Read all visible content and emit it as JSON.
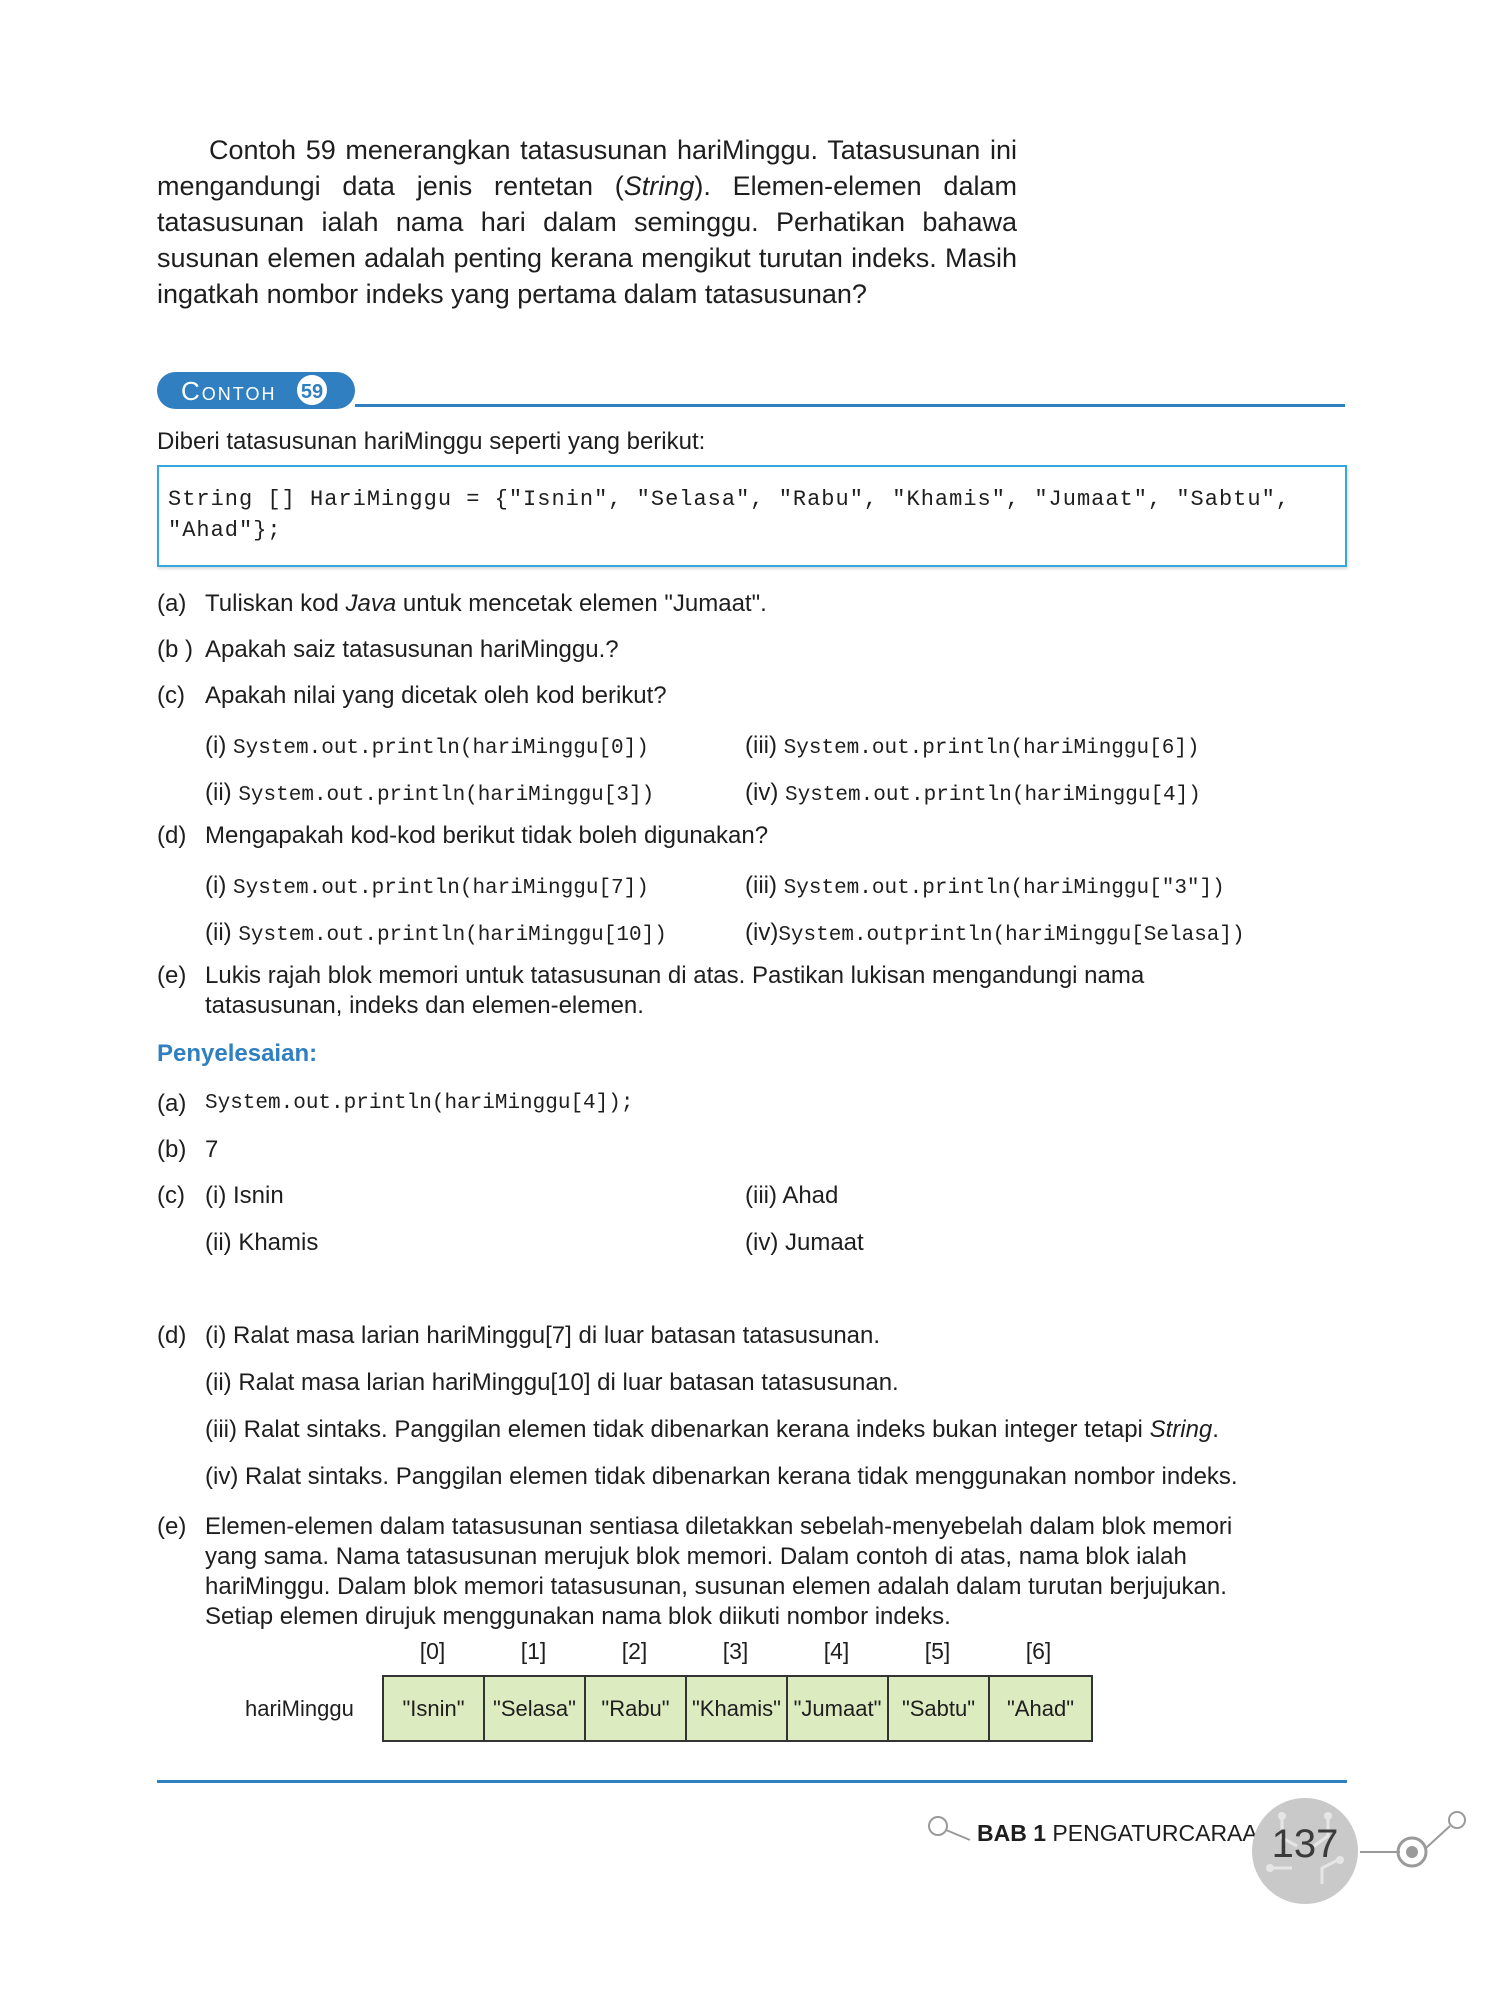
{
  "intro": {
    "text_before": "Contoh 59 menerangkan tatasusunan hariMinggu. Tatasusunan ini mengandungi data jenis rentetan (",
    "text_italic": "String",
    "text_after": "). Elemen-elemen dalam tatasusunan ialah nama hari dalam seminggu. Perhatikan bahawa susunan elemen adalah penting kerana mengikut turutan indeks. Masih ingatkah nombor indeks yang pertama dalam tatasusunan?"
  },
  "example": {
    "label": "Contoh",
    "number": "59",
    "lead": "Diberi tatasusunan hariMinggu seperti yang berikut:",
    "code_line1": "String [] HariMinggu = {\"Isnin\", \"Selasa\", \"Rabu\", \"Khamis\", \"Jumaat\", \"Sabtu\",",
    "code_line2": "\"Ahad\"};"
  },
  "questions": {
    "a_mark": "(a)",
    "a_pre": "Tuliskan kod ",
    "a_it": "Java",
    "a_post": " untuk mencetak elemen \"Jumaat\".",
    "b_mark": "(b )",
    "b_text": "Apakah saiz tatasusunan hariMinggu.?",
    "c_mark": "(c)",
    "c_text": "Apakah nilai yang dicetak oleh kod berikut?",
    "c_i_mark": "(i)",
    "c_i_code": "System.out.println(hariMinggu[0])",
    "c_iii_mark": "(iii)",
    "c_iii_code": "System.out.println(hariMinggu[6])",
    "c_ii_mark": "(ii)",
    "c_ii_code": "System.out.println(hariMinggu[3])",
    "c_iv_mark": "(iv)",
    "c_iv_code": "System.out.println(hariMinggu[4])",
    "d_mark": "(d)",
    "d_text": "Mengapakah kod-kod berikut tidak boleh digunakan?",
    "d_i_mark": "(i)",
    "d_i_code": "System.out.println(hariMinggu[7])",
    "d_iii_mark": "(iii)",
    "d_iii_code": "System.out.println(hariMinggu[\"3\"])",
    "d_ii_mark": "(ii)",
    "d_ii_code": "System.out.println(hariMinggu[10])",
    "d_iv_mark": "(iv)",
    "d_iv_code": "System.outprintln(hariMinggu[Selasa])",
    "e_mark": "(e)",
    "e_line1": "Lukis rajah blok memori untuk tatasusunan di atas. Pastikan lukisan mengandungi nama",
    "e_line2": "tatasusunan, indeks dan elemen-elemen."
  },
  "solution": {
    "heading": "Penyelesaian:",
    "a_mark": "(a)",
    "a_code": "System.out.println(hariMinggu[4]);",
    "b_mark": "(b)",
    "b_text": "7",
    "c_mark": "(c)",
    "c_i": "(i)  Isnin",
    "c_iii": "(iii)  Ahad",
    "c_ii": "(ii)  Khamis",
    "c_iv": "(iv)  Jumaat",
    "d_mark": "(d)",
    "d_i": "(i)  Ralat masa larian hariMinggu[7] di luar batasan tatasusunan.",
    "d_ii": "(ii)  Ralat masa larian hariMinggu[10] di luar batasan tatasusunan.",
    "d_iii_pre": "(iii) Ralat sintaks. Panggilan elemen tidak dibenarkan kerana indeks bukan integer tetapi ",
    "d_iii_it": "String",
    "d_iii_post": ".",
    "d_iv": "(iv) Ralat sintaks. Panggilan elemen tidak dibenarkan kerana tidak menggunakan nombor indeks.",
    "e_mark": "(e)",
    "e_line1": "Elemen-elemen dalam tatasusunan sentiasa diletakkan sebelah-menyebelah dalam blok memori",
    "e_line2": "yang sama. Nama tatasusunan merujuk blok memori. Dalam contoh di atas, nama blok ialah",
    "e_line3": "hariMinggu. Dalam blok memori tatasusunan, susunan elemen adalah dalam turutan berjujukan.",
    "e_line4": "Setiap elemen dirujuk menggunakan nama blok diikuti nombor indeks."
  },
  "memory_block": {
    "array_name": "hariMinggu",
    "indices": [
      "[0]",
      "[1]",
      "[2]",
      "[3]",
      "[4]",
      "[5]",
      "[6]"
    ],
    "elements": [
      "\"Isnin\"",
      "\"Selasa\"",
      "\"Rabu\"",
      "\"Khamis\"",
      "\"Jumaat\"",
      "\"Sabtu\"",
      "\"Ahad\""
    ],
    "cell_color": "#dcebc0"
  },
  "footer": {
    "bab": "BAB 1",
    "chapter": "PENGATURCARAAN",
    "page": "137"
  },
  "colors": {
    "accent": "#2f7fc1",
    "code_border": "#36a6de"
  }
}
